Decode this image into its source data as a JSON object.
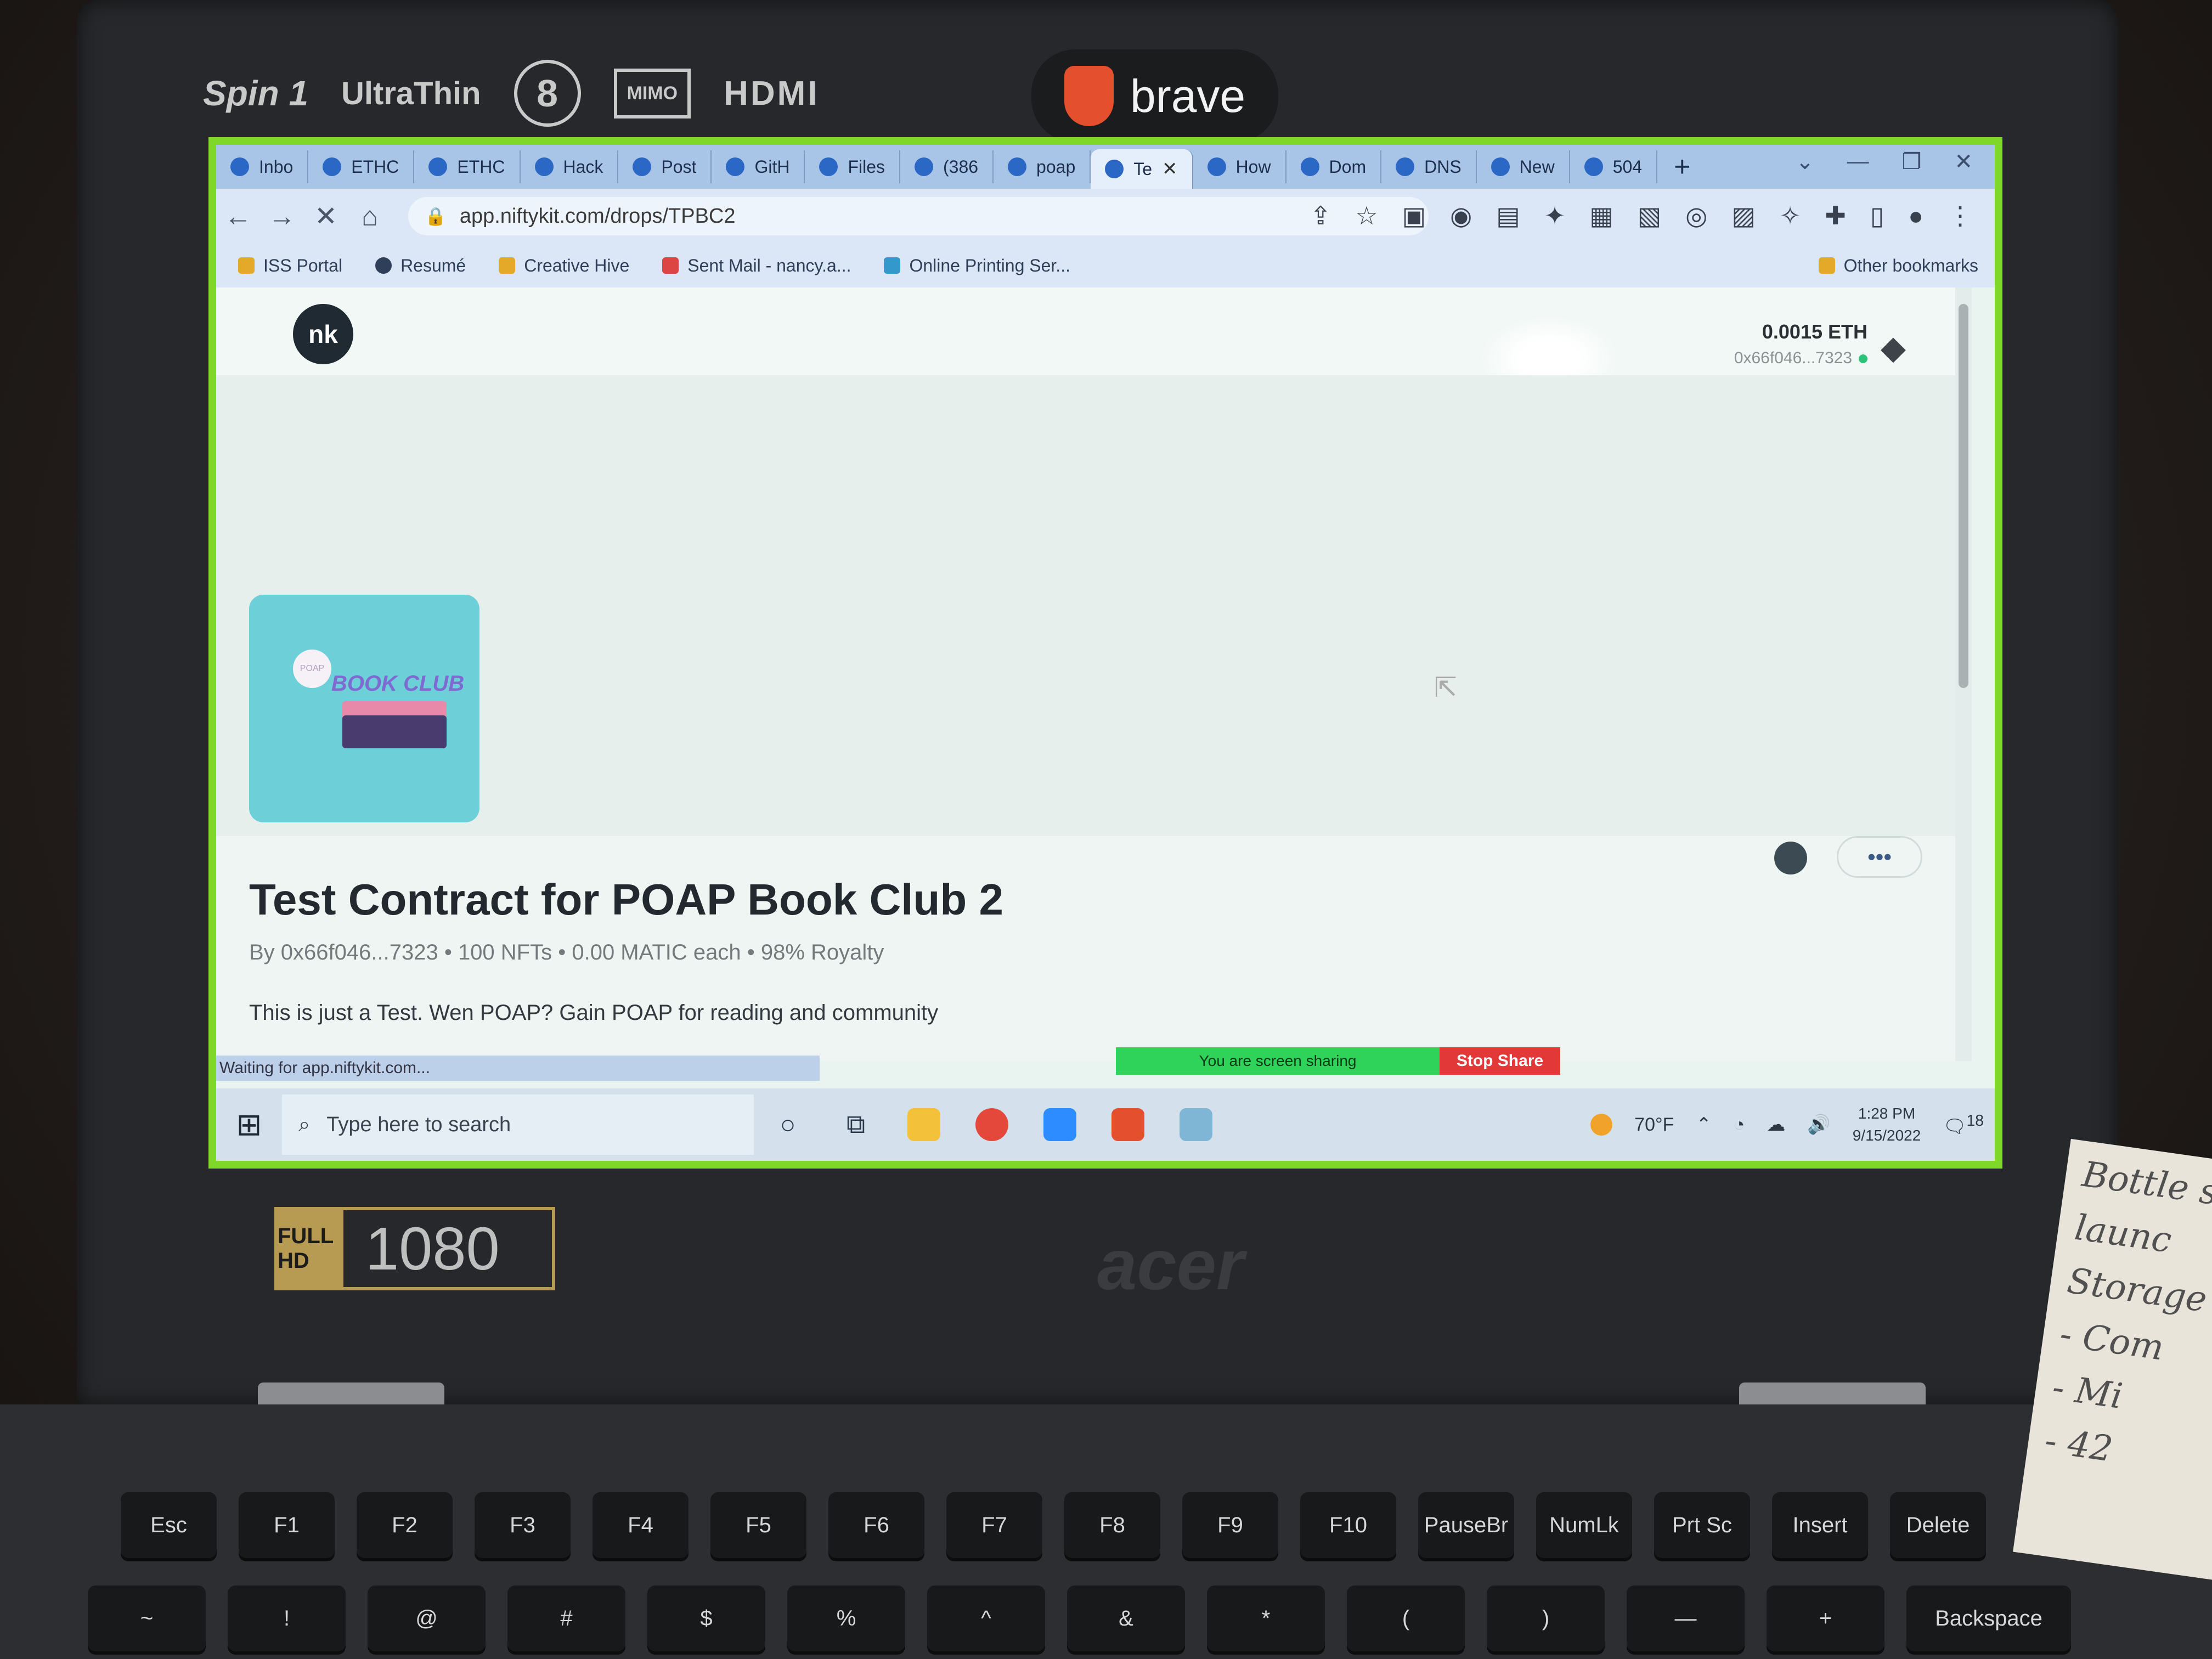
{
  "laptop": {
    "stickers": [
      "Spin 1",
      "UltraThin",
      "8",
      "MIMO",
      "HDMI"
    ],
    "brave_sticker": "brave",
    "hd_badge": {
      "full": "FULL HD",
      "resolution": "1080"
    },
    "brand": "acer"
  },
  "browser": {
    "tabs": [
      {
        "label": "Inbo",
        "icon": "gmail-icon",
        "active": false
      },
      {
        "label": "ETHC",
        "icon": "globe-icon",
        "active": false
      },
      {
        "label": "ETHC",
        "icon": "globe-icon",
        "active": false
      },
      {
        "label": "Hack",
        "icon": "person-icon",
        "active": false
      },
      {
        "label": "Post",
        "icon": "zoom-icon",
        "active": false
      },
      {
        "label": "GitH",
        "icon": "github-icon",
        "active": false
      },
      {
        "label": "Files",
        "icon": "files-icon",
        "active": false
      },
      {
        "label": "(386",
        "icon": "badge-icon",
        "active": false
      },
      {
        "label": "poap",
        "icon": "u-icon",
        "active": false
      },
      {
        "label": "Te",
        "icon": "loading-icon",
        "active": true
      },
      {
        "label": "How",
        "icon": "u-icon",
        "active": false
      },
      {
        "label": "Dom",
        "icon": "globe-icon",
        "active": false
      },
      {
        "label": "DNS",
        "icon": "globe-icon",
        "active": false
      },
      {
        "label": "New",
        "icon": "brave-icon",
        "active": false
      },
      {
        "label": "504",
        "icon": "leaf-icon",
        "active": false
      }
    ],
    "new_tab_label": "+",
    "url": "app.niftykit.com/drops/TPBC2",
    "bookmarks": [
      {
        "label": "ISS Portal"
      },
      {
        "label": "Resumé"
      },
      {
        "label": "Creative Hive"
      },
      {
        "label": "Sent Mail - nancy.a..."
      },
      {
        "label": "Online Printing Ser..."
      }
    ],
    "other_bookmarks": "Other bookmarks",
    "status_text": "Waiting for app.niftykit.com..."
  },
  "page": {
    "logo_text": "nk",
    "wallet_balance": "0.0015 ETH",
    "wallet_address": "0x66f046...7323",
    "thumbnail": {
      "badge": "POAP",
      "text": "BOOK CLUB"
    },
    "more_button": "•••",
    "title": "Test Contract for POAP Book Club 2",
    "meta": "By 0x66f046...7323 • 100 NFTs • 0.00 MATIC each • 98% Royalty",
    "description": "This is just a Test. Wen POAP? Gain POAP for reading and community"
  },
  "screen_share": {
    "status": "You are screen sharing",
    "stop_label": "Stop Share"
  },
  "taskbar": {
    "search_placeholder": "Type here to search",
    "weather": "70°F",
    "time": "1:28 PM",
    "date": "9/15/2022",
    "notifications": "18"
  },
  "keyboard": {
    "keys": [
      "Esc",
      "F1",
      "F2",
      "F3",
      "F4",
      "F5",
      "F6",
      "F7",
      "F8",
      "F9",
      "F10",
      "PauseBr",
      "NumLk",
      "Prt Sc",
      "Insert",
      "Delete"
    ],
    "row2": [
      "~",
      "!",
      "@",
      "#",
      "$",
      "%",
      "^",
      "&",
      "*",
      "(",
      ")",
      "—",
      "+",
      "Backspace"
    ]
  },
  "paper_note": [
    "Bottle s",
    "launc",
    "Storage",
    "- Com",
    "- Mi",
    "- 42"
  ],
  "colors": {
    "screen_border": "#7fd72a",
    "share_green": "#2fd35a",
    "stop_red": "#e23838",
    "thumbnail": "#6dd0d8"
  }
}
